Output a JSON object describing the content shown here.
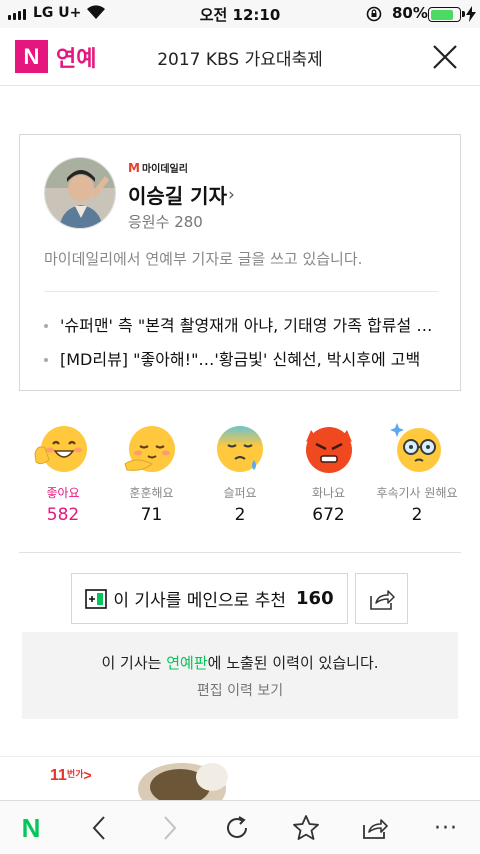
{
  "status_bar": {
    "carrier": "LG U+",
    "time": "오전 12:10",
    "battery_percent": "80%",
    "battery_level": 0.8
  },
  "header": {
    "logo": "N",
    "section": "연예",
    "title": "2017 KBS 가요대축제",
    "close_icon": "close-icon"
  },
  "reporter": {
    "press": "마이데일리",
    "name": "이승길 기자",
    "subscriber_label": "응원수",
    "subscriber_count": "280",
    "description": "마이데일리에서 연예부 기자로 글을 쓰고 있습니다.",
    "articles": [
      "'슈퍼맨' 측 \"본격 촬영재개 아냐, 기태영 가족 합류설 사실무근\"",
      "[MD리뷰] \"좋아해!\"…'황금빛' 신혜선, 박시후에 고백"
    ]
  },
  "reactions": [
    {
      "label": "좋아요",
      "count": "582",
      "icon": "like-face-icon",
      "active": true
    },
    {
      "label": "훈훈해요",
      "count": "71",
      "icon": "warm-face-icon",
      "active": false
    },
    {
      "label": "슬퍼요",
      "count": "2",
      "icon": "sad-face-icon",
      "active": false
    },
    {
      "label": "화나요",
      "count": "672",
      "icon": "angry-face-icon",
      "active": false
    },
    {
      "label": "후속기사 원해요",
      "count": "2",
      "icon": "want-more-face-icon",
      "active": false
    }
  ],
  "recommend": {
    "label": "이 기사를 메인으로 추천",
    "count": "160",
    "share_icon": "share-icon"
  },
  "exposure": {
    "prefix": "이 기사는 ",
    "highlight": "연예판",
    "suffix": "에 노출된 이력이 있습니다.",
    "link": "편집 이력 보기"
  },
  "ad": {
    "brand": "11",
    "brand_suffix": "번가"
  },
  "toolbar": {
    "home": "N",
    "more": "···"
  },
  "colors": {
    "brand_pink": "#e5177e",
    "naver_green": "#03c75a"
  }
}
